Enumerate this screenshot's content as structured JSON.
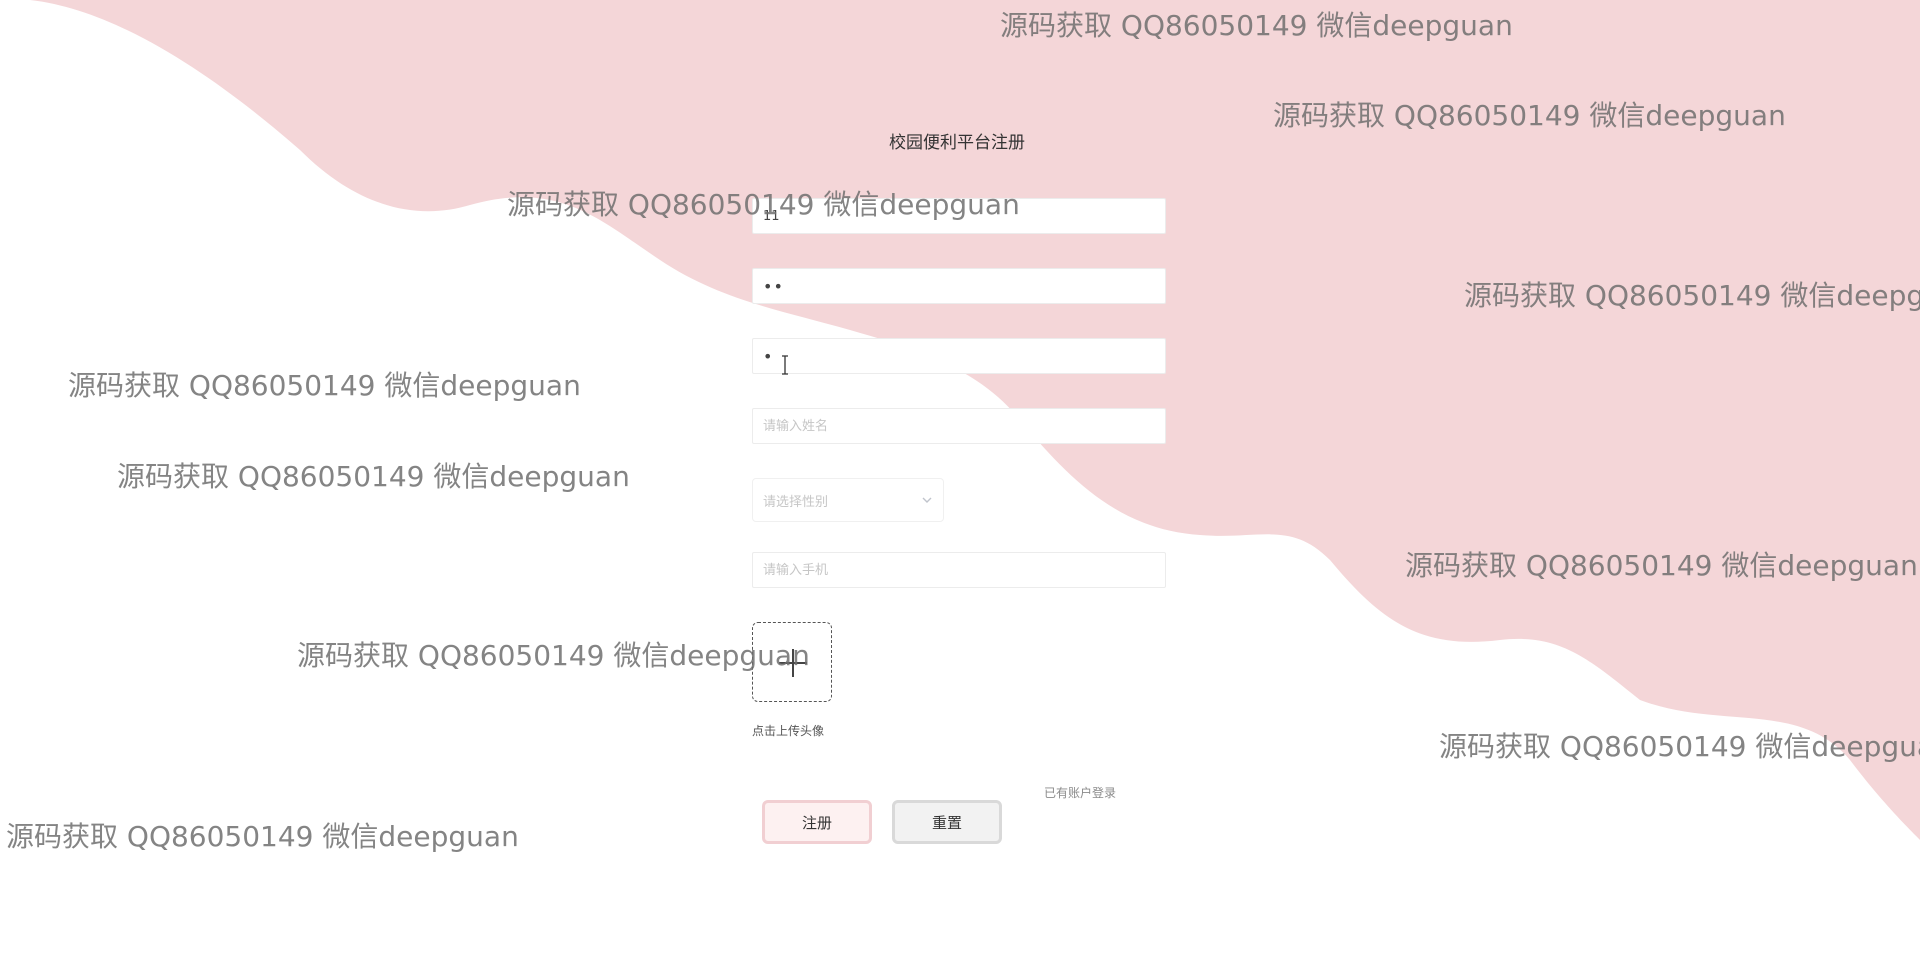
{
  "page": {
    "title": "校园便利平台注册"
  },
  "colors": {
    "wave_pink": "#f4d6d8",
    "background": "#ffffff",
    "register_border": "#f1cfd2",
    "reset_border": "#d9d9d9"
  },
  "form": {
    "account_value": "11",
    "password_value": "••",
    "confirm_value": "•",
    "name_placeholder": "请输入姓名",
    "gender_placeholder": "请选择性别",
    "phone_placeholder": "请输入手机",
    "upload_hint": "点击上传头像",
    "login_link": "已有账户登录",
    "register_label": "注册",
    "reset_label": "重置"
  },
  "icons": {
    "gender_chevron": "chevron-down-icon",
    "upload": "plus-icon",
    "cursor": "text-cursor-icon"
  },
  "watermark": {
    "text": "源码获取 QQ86050149 微信deepguan"
  }
}
